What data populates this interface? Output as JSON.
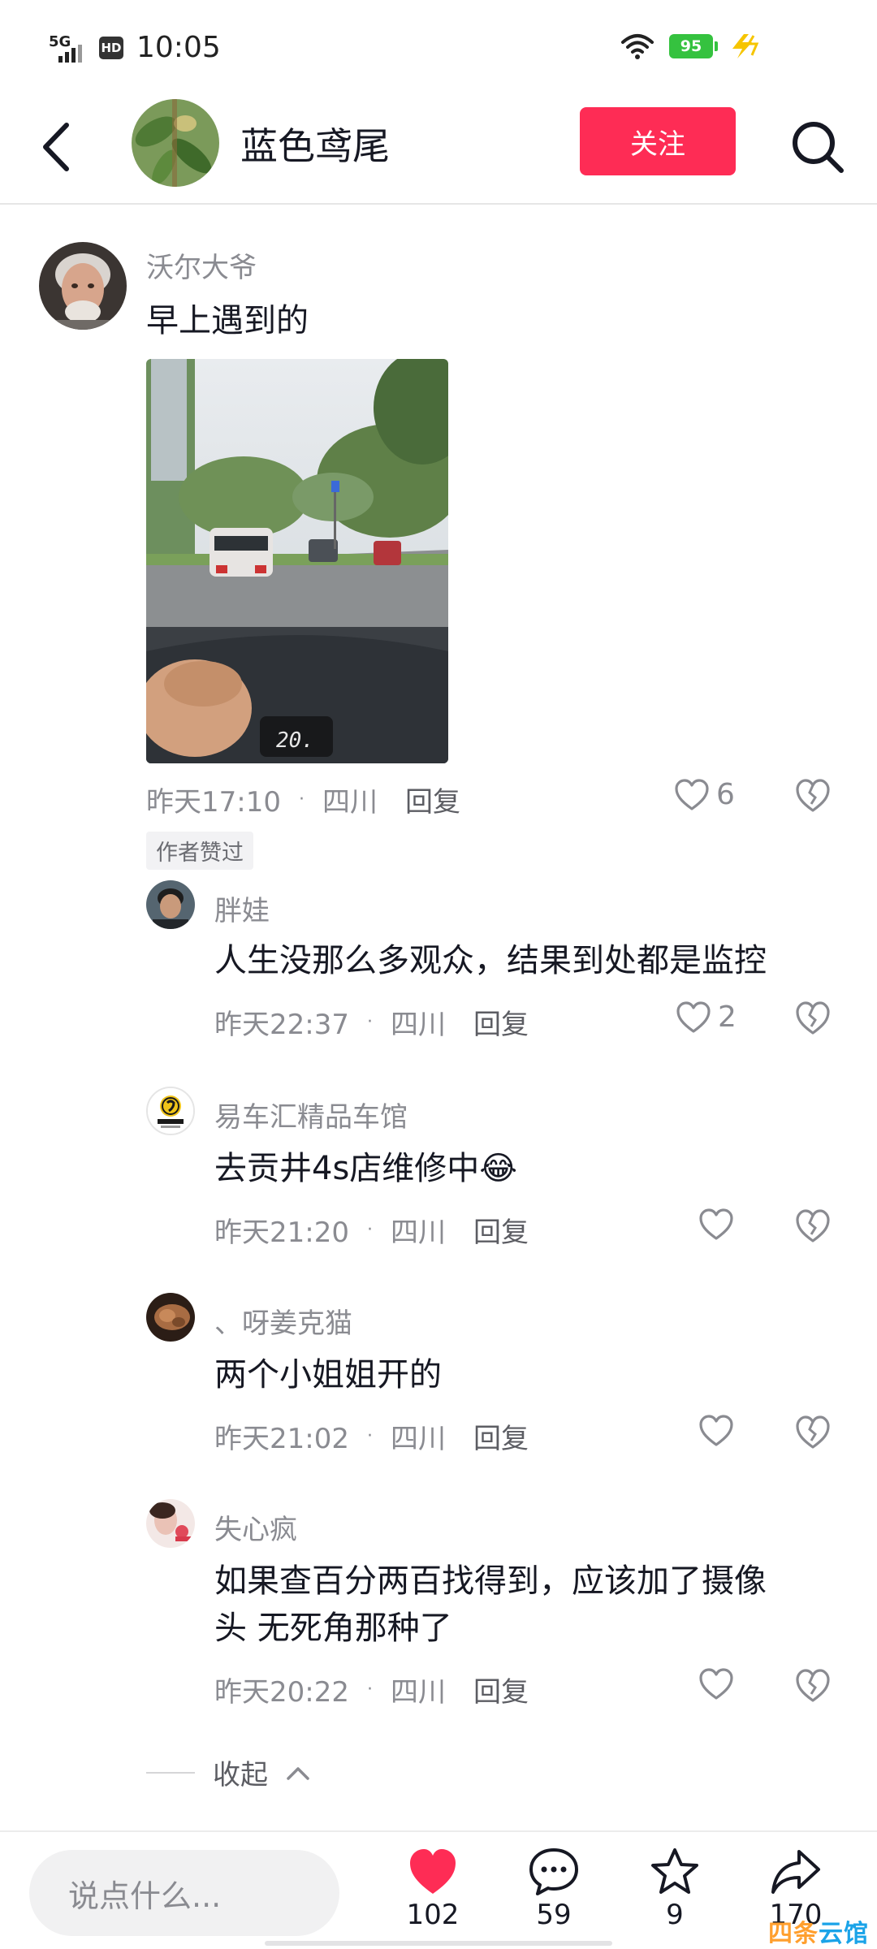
{
  "status_bar": {
    "network": "5G",
    "hd": "HD",
    "time": "10:05",
    "battery": "95"
  },
  "header": {
    "title": "蓝色鸢尾",
    "follow_label": "关注"
  },
  "main_comment": {
    "username": "沃尔大爷",
    "text": "早上遇到的",
    "time": "昨天17:10",
    "location": "四川",
    "reply_label": "回复",
    "likes": "6",
    "author_tag": "作者赞过"
  },
  "replies": [
    {
      "username": "胖娃",
      "text": "人生没那么多观众，结果到处都是监控",
      "time": "昨天22:37",
      "location": "四川",
      "reply_label": "回复",
      "likes": "2"
    },
    {
      "username": "易车汇精品车馆",
      "text": "去贡井4s店维修中",
      "emoji": "😂",
      "time": "昨天21:20",
      "location": "四川",
      "reply_label": "回复",
      "likes": ""
    },
    {
      "username": "、呀姜克猫",
      "text": "两个小姐姐开的",
      "time": "昨天21:02",
      "location": "四川",
      "reply_label": "回复",
      "likes": ""
    },
    {
      "username": "失心疯",
      "text_line1": "如果查百分两百找得到，应该加了摄像",
      "text_line2": "头 无死角那种了",
      "time": "昨天20:22",
      "location": "四川",
      "reply_label": "回复",
      "likes": ""
    }
  ],
  "collapse_label": "收起",
  "bottom": {
    "input_placeholder": "说点什么...",
    "likes": "102",
    "comments": "59",
    "favorites": "9",
    "shares": "170"
  },
  "watermark": {
    "part1": "四条",
    "part2": "云馆"
  },
  "colors": {
    "accent": "#fe2c55",
    "meta_gray": "#8a8b91",
    "battery_green": "#35c23f"
  },
  "icons": [
    "back-icon",
    "search-icon",
    "heart-outline-icon",
    "broken-heart-icon",
    "heart-filled-icon",
    "comment-icon",
    "star-icon",
    "share-icon"
  ]
}
